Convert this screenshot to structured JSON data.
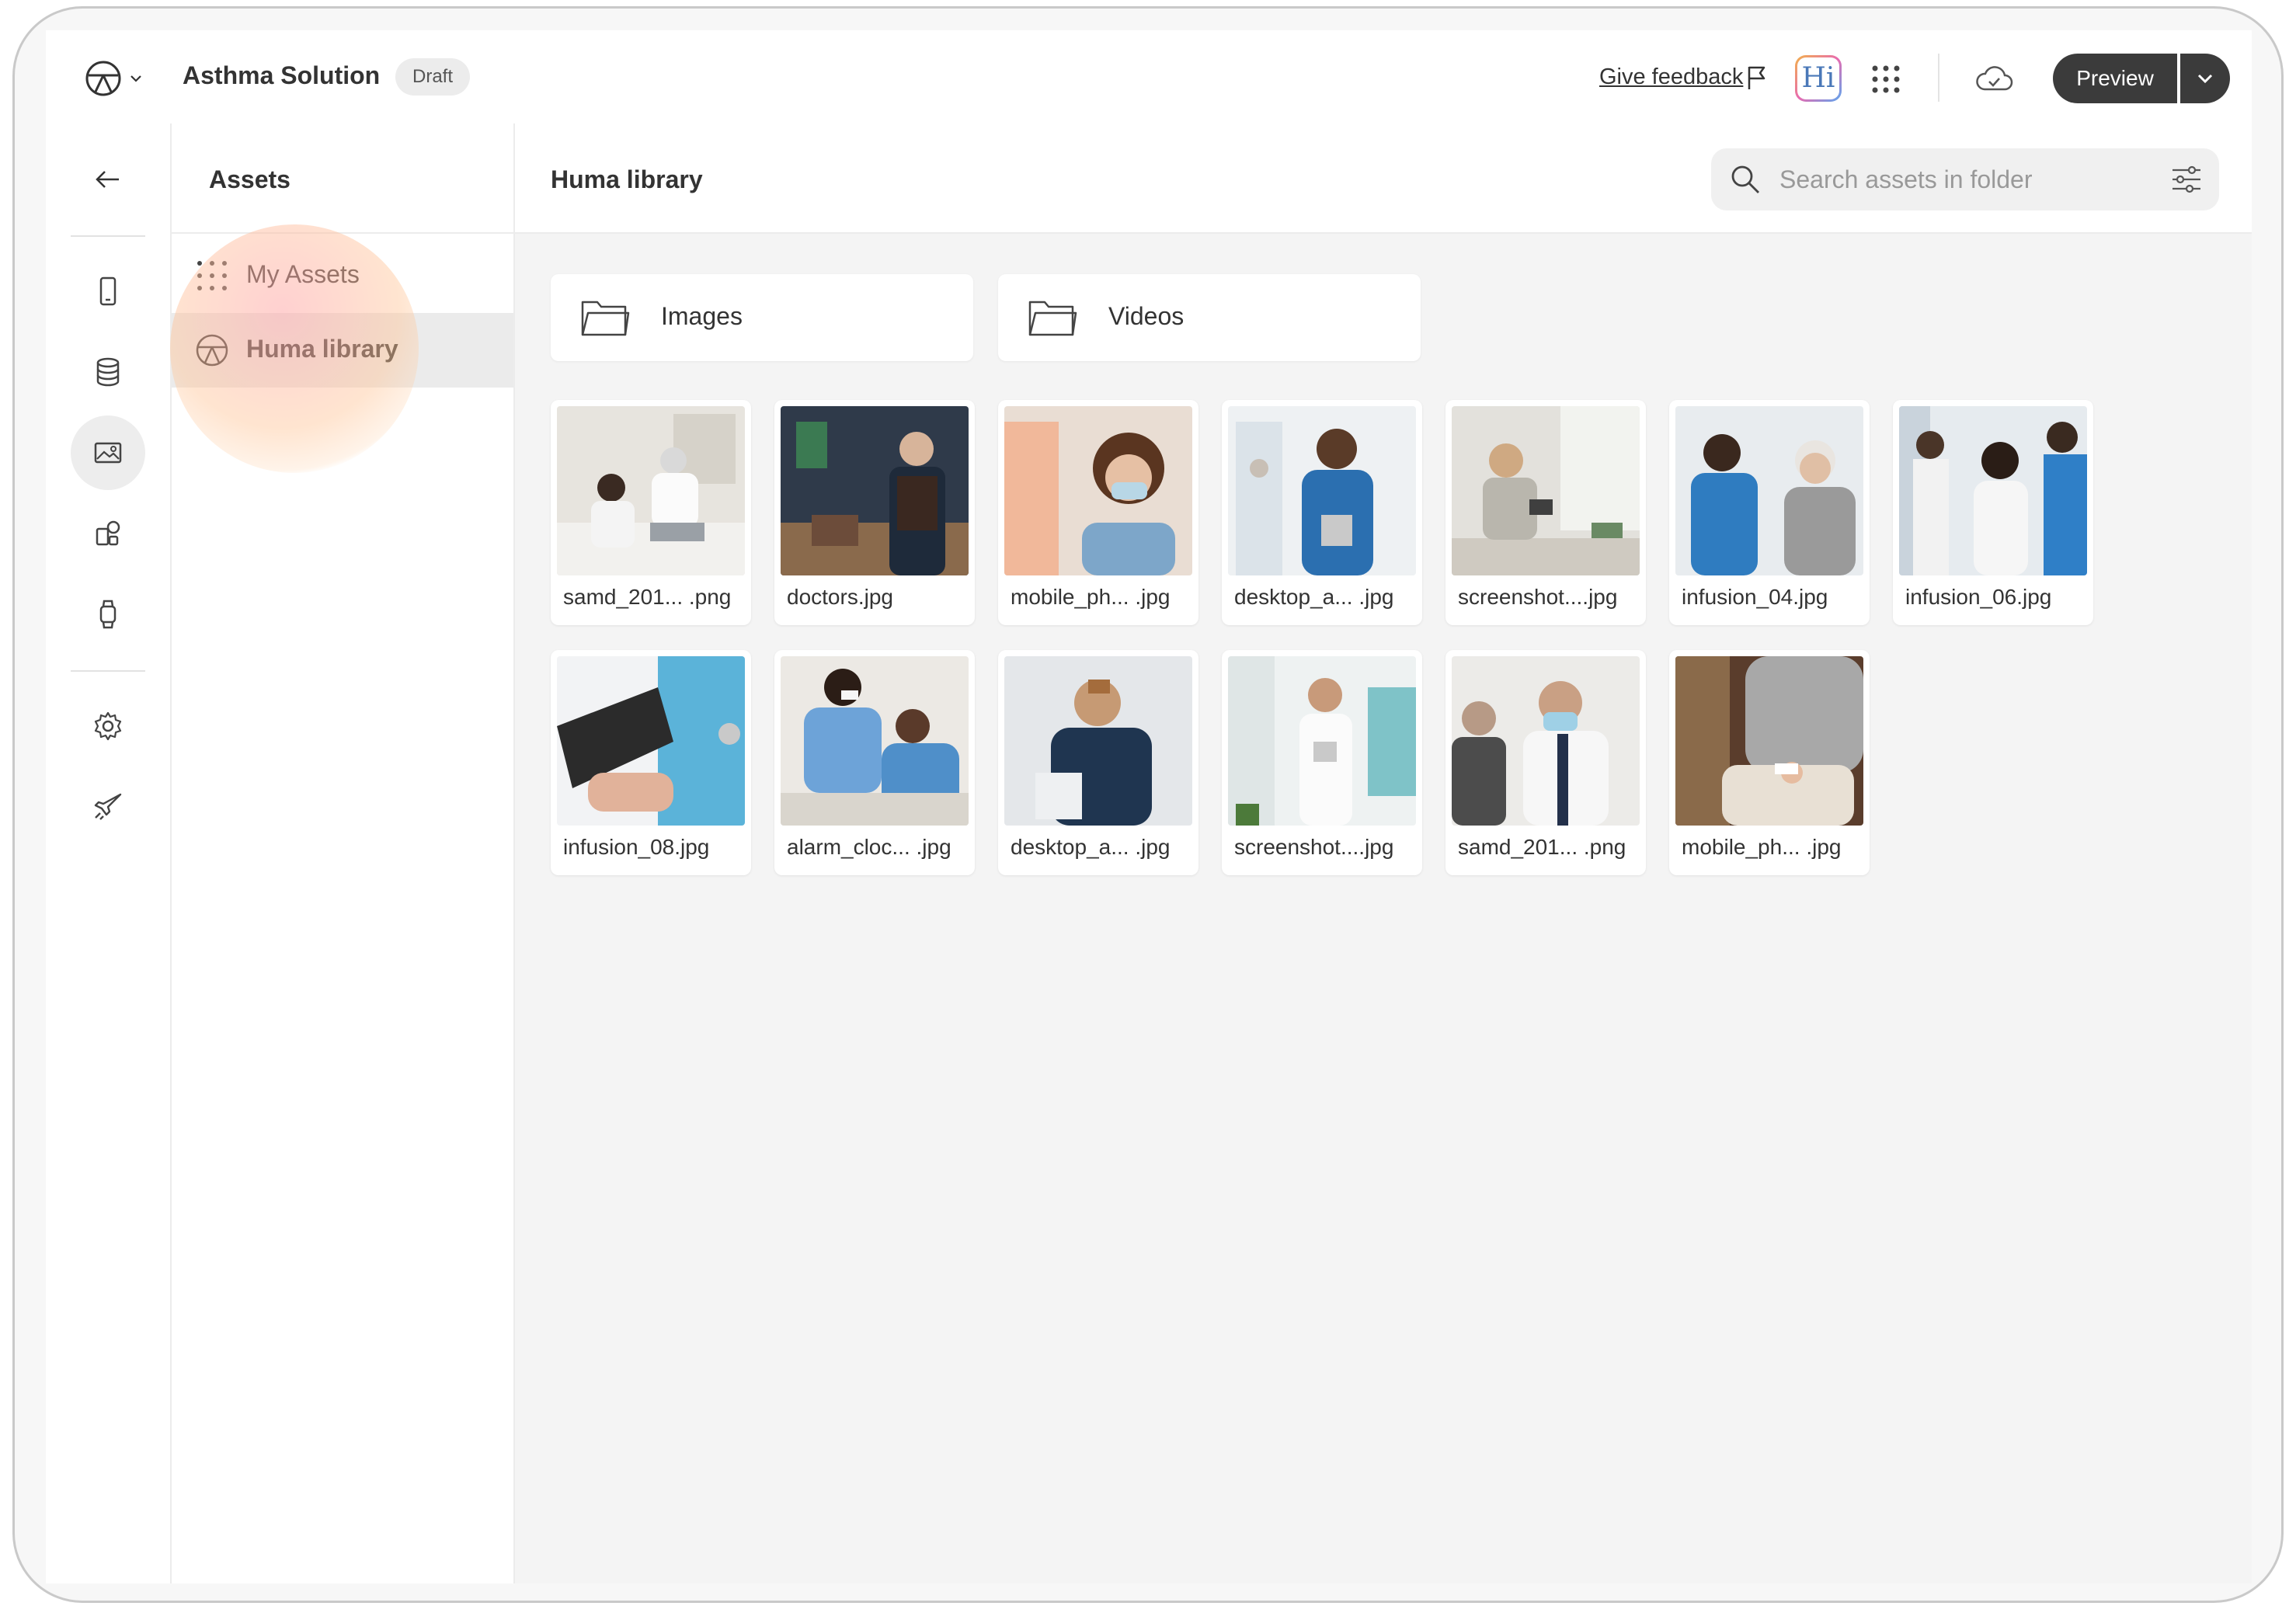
{
  "topbar": {
    "app_title": "Asthma Solution",
    "status_badge": "Draft",
    "feedback_label": "Give feedback",
    "hi_label": "Hi",
    "preview_label": "Preview"
  },
  "rail": {
    "items": [
      "back-arrow-icon",
      "mobile-icon",
      "database-icon",
      "image-icon",
      "module-icon",
      "watch-icon",
      "settings-icon",
      "rocket-icon"
    ],
    "active": "image-icon"
  },
  "sidebar": {
    "title": "Assets",
    "items": [
      {
        "label": "My Assets",
        "icon": "dots-grid-icon",
        "selected": false
      },
      {
        "label": "Huma library",
        "icon": "huma-logo-icon",
        "selected": true
      }
    ]
  },
  "main": {
    "title": "Huma library",
    "search": {
      "placeholder": "Search assets in folder",
      "value": ""
    },
    "folders": [
      {
        "label": "Images",
        "icon": "folder-icon"
      },
      {
        "label": "Videos",
        "icon": "folder-icon"
      }
    ],
    "assets": [
      {
        "name": "samd_201... .png"
      },
      {
        "name": "doctors.jpg"
      },
      {
        "name": "mobile_ph... .jpg"
      },
      {
        "name": "desktop_a... .jpg"
      },
      {
        "name": "screenshot....jpg"
      },
      {
        "name": "infusion_04.jpg"
      },
      {
        "name": "infusion_06.jpg"
      },
      {
        "name": "infusion_08.jpg"
      },
      {
        "name": "alarm_cloc... .jpg"
      },
      {
        "name": "desktop_a... .jpg"
      },
      {
        "name": "screenshot....jpg"
      },
      {
        "name": "samd_201... .png"
      },
      {
        "name": "mobile_ph... .jpg"
      }
    ]
  },
  "colors": {
    "primary_button": "#3b3b3b",
    "selected_row": "#ebebeb",
    "canvas": "#f4f4f4"
  }
}
